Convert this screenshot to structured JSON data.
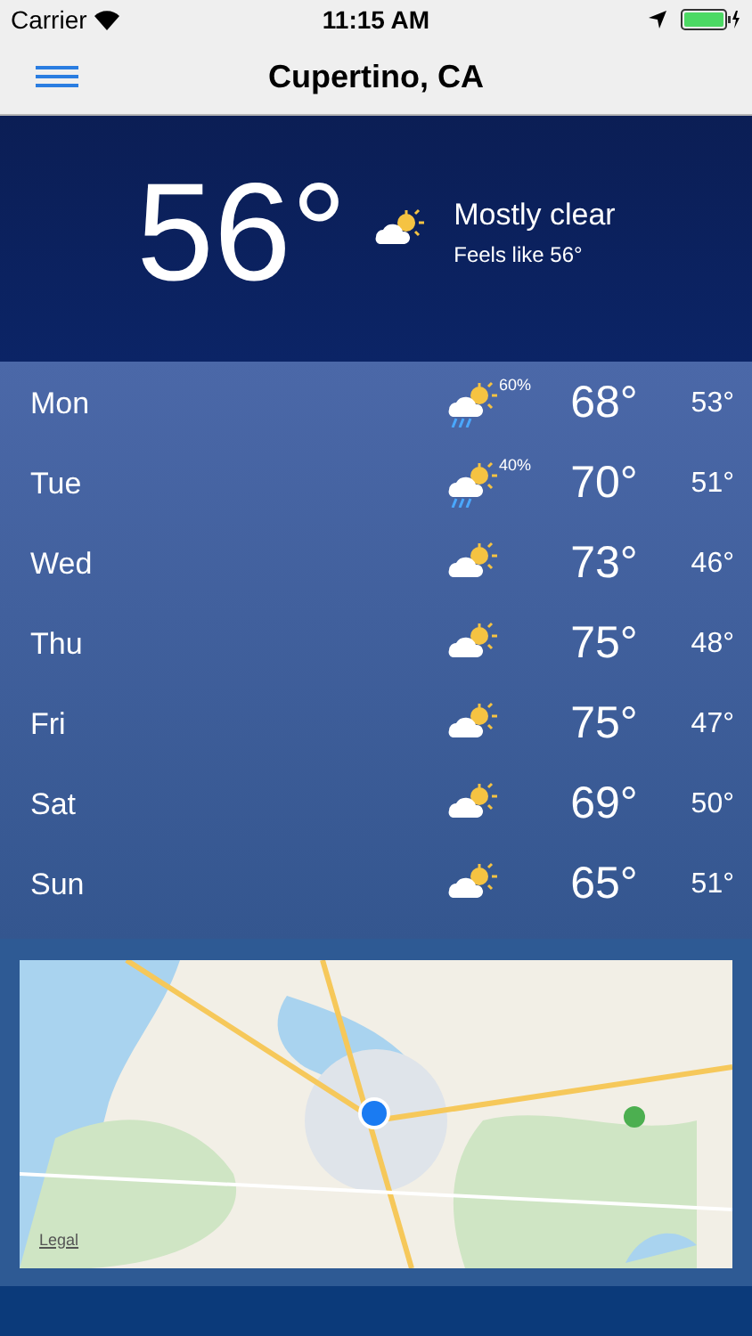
{
  "status_bar": {
    "carrier": "Carrier",
    "time": "11:15 AM"
  },
  "nav": {
    "title": "Cupertino, CA"
  },
  "current": {
    "temperature": "56°",
    "kind": "partly-cloudy",
    "condition": "Mostly clear",
    "feels_like": "Feels like 56°"
  },
  "forecast": [
    {
      "day": "Mon",
      "kind": "rain",
      "precip": "60%",
      "high": "68°",
      "low": "53°"
    },
    {
      "day": "Tue",
      "kind": "rain",
      "precip": "40%",
      "high": "70°",
      "low": "51°"
    },
    {
      "day": "Wed",
      "kind": "partly-cloudy",
      "high": "73°",
      "low": "46°"
    },
    {
      "day": "Thu",
      "kind": "partly-cloudy",
      "high": "75°",
      "low": "48°"
    },
    {
      "day": "Fri",
      "kind": "partly-cloudy",
      "high": "75°",
      "low": "47°"
    },
    {
      "day": "Sat",
      "kind": "partly-cloudy",
      "high": "69°",
      "low": "50°"
    },
    {
      "day": "Sun",
      "kind": "partly-cloudy",
      "high": "65°",
      "low": "51°"
    }
  ],
  "map": {
    "kind": "picture",
    "legal_link": "Legal"
  }
}
